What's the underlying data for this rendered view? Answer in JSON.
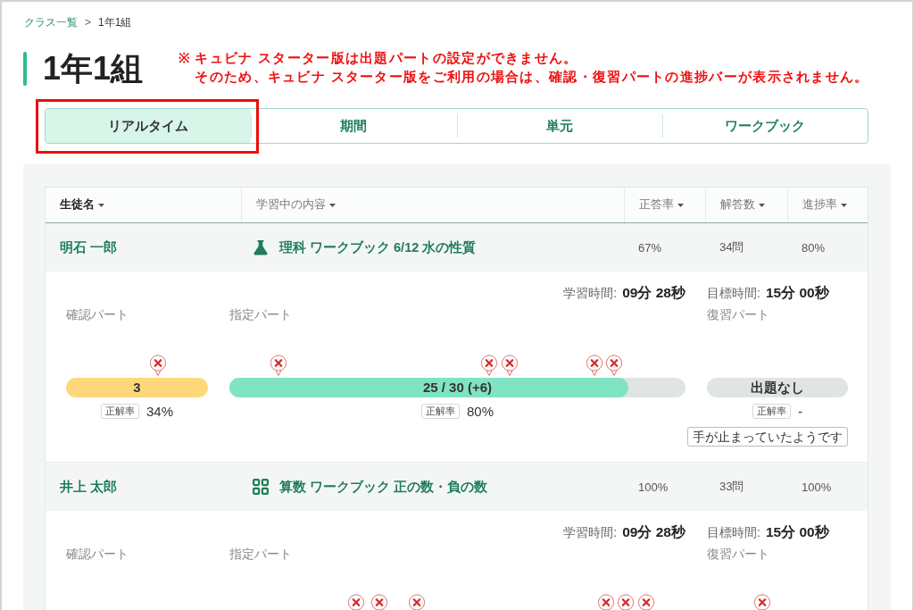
{
  "breadcrumb": {
    "items": [
      {
        "label": "クラス一覧",
        "link": true
      },
      {
        "label": "1年1組",
        "link": false
      }
    ],
    "separator": ">"
  },
  "page_title": "1年1組",
  "notice": {
    "mark": "※",
    "lines": [
      "キュビナ スターター版は出題パートの設定ができません。",
      "そのため、キュビナ スターター版をご利用の場合は、確認・復習パートの進捗バーが表示されません。"
    ]
  },
  "tabs": [
    {
      "label": "リアルタイム",
      "selected": true,
      "highlighted": true
    },
    {
      "label": "期間",
      "selected": false,
      "highlighted": false
    },
    {
      "label": "単元",
      "selected": false,
      "highlighted": false
    },
    {
      "label": "ワークブック",
      "selected": false,
      "highlighted": false
    }
  ],
  "table": {
    "columns": [
      {
        "label": "生徒名",
        "sorted": true
      },
      {
        "label": "学習中の内容",
        "sorted": false
      },
      {
        "label": "正答率",
        "sorted": false
      },
      {
        "label": "解答数",
        "sorted": false
      },
      {
        "label": "進捗率",
        "sorted": false
      }
    ],
    "rows": [
      {
        "name": "明石 一郎",
        "content": {
          "kind": "science",
          "text": "理科 ワークブック 6/12 水の性質"
        },
        "accuracy": "67%",
        "answers": "34問",
        "progress": "80%",
        "details": {
          "study_time": {
            "label": "学習時間:",
            "value": "09分 28秒"
          },
          "target_time": {
            "label": "目標時間:",
            "value": "15分 00秒"
          },
          "parts": [
            {
              "kind": "check",
              "label": "確認パート",
              "markers": [
                {
                  "level": 0.648
                }
              ],
              "bar": {
                "kind": "count",
                "text": "3"
              },
              "rate": {
                "label": "正解率",
                "value": "34%"
              }
            },
            {
              "kind": "assigned",
              "label": "指定パート",
              "markers": [
                {
                  "level": 0.108
                },
                {
                  "level": 0.569
                },
                {
                  "level": 0.614
                },
                {
                  "level": 0.8
                },
                {
                  "level": 0.843
                }
              ],
              "bar": {
                "kind": "progress",
                "text": "25 / 30 (+6)",
                "level": 0.875
              },
              "rate": {
                "label": "正解率",
                "value": "80%"
              }
            },
            {
              "kind": "review",
              "label": "復習パート",
              "bar": {
                "kind": "empty",
                "text": "出題なし"
              },
              "rate": {
                "label": "正解率",
                "value": "-"
              }
            }
          ],
          "alert_button": "手が止まっていたようです"
        }
      },
      {
        "name": "井上 太郎",
        "content": {
          "kind": "math",
          "text": "算数 ワークブック 正の数・負の数"
        },
        "accuracy": "100%",
        "answers": "33問",
        "progress": "100%",
        "details": {
          "study_time": {
            "label": "学習時間:",
            "value": "09分 28秒"
          },
          "target_time": {
            "label": "目標時間:",
            "value": "15分 00秒"
          },
          "parts": [
            {
              "kind": "check",
              "label": "確認パート"
            },
            {
              "kind": "assigned",
              "label": "指定パート",
              "markers": [
                {
                  "level": 0.278
                },
                {
                  "level": 0.329
                },
                {
                  "level": 0.41
                },
                {
                  "level": 0.825
                },
                {
                  "level": 0.869
                },
                {
                  "level": 0.914
                }
              ]
            },
            {
              "kind": "review",
              "label": "復習パート",
              "markers": [
                {
                  "level": 0.39
                }
              ]
            }
          ]
        }
      }
    ]
  }
}
